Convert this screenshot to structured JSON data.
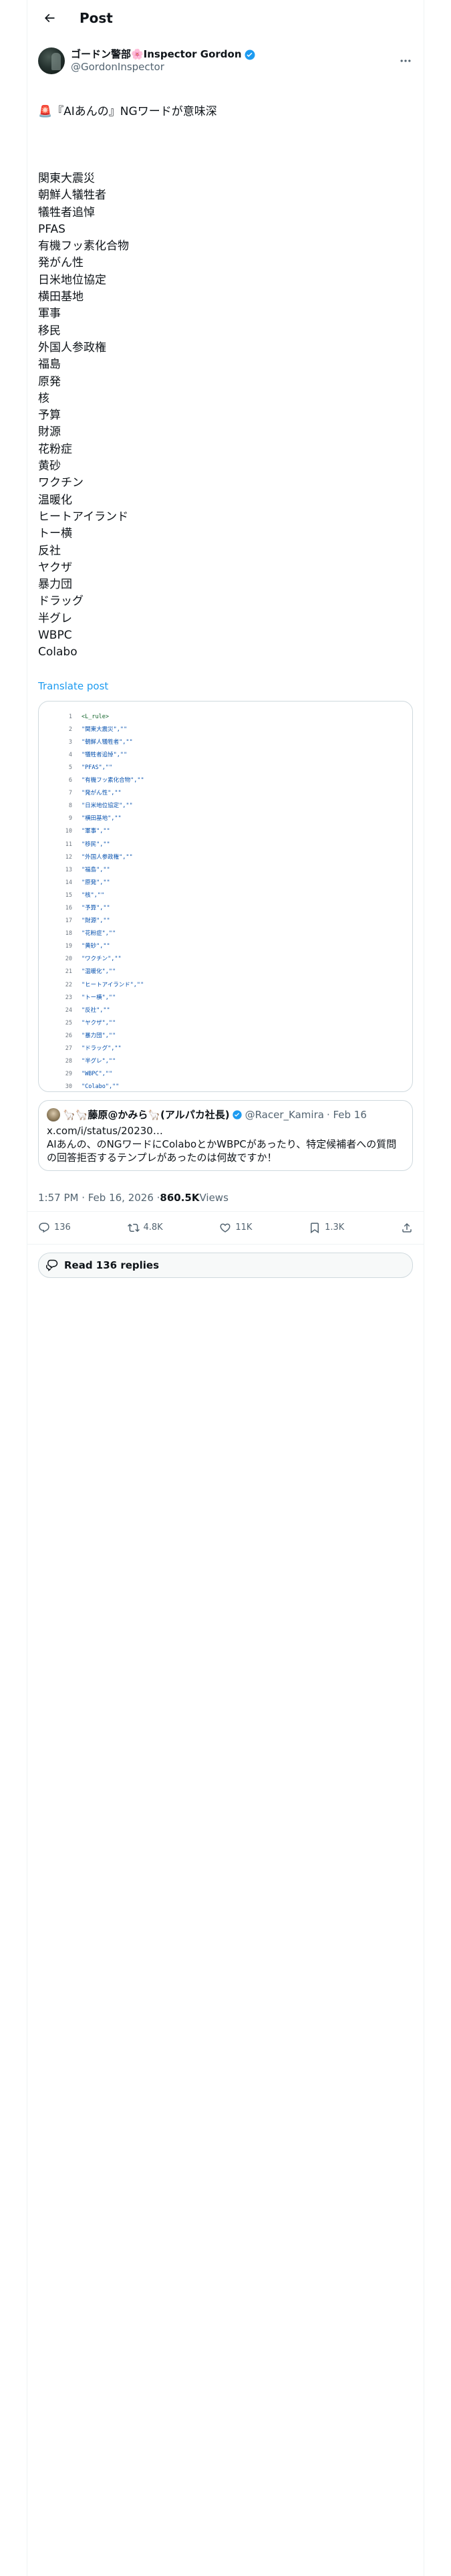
{
  "header": {
    "title": "Post"
  },
  "author": {
    "name": "ゴードン警部🌸Inspector Gordon",
    "handle": "@GordonInspector"
  },
  "tweet": {
    "headline": "🚨『AIあんの』NGワードが意味深",
    "lines": [
      "関東大震災",
      "朝鮮人犠牲者",
      "犠牲者追悼",
      "PFAS",
      "有機フッ素化合物",
      "発がん性",
      "日米地位協定",
      "横田基地",
      "軍事",
      "移民",
      "外国人参政権",
      "福島",
      "原発",
      "核",
      "予算",
      "財源",
      "花粉症",
      "黄砂",
      "ワクチン",
      "温暖化",
      "ヒートアイランド",
      "トー横",
      "反社",
      "ヤクザ",
      "暴力団",
      "ドラッグ",
      "半グレ",
      "WBPC",
      "Colabo"
    ],
    "translate_label": "Translate post"
  },
  "code_image": {
    "rows": [
      {
        "n": "1",
        "t": "<L_rule>"
      },
      {
        "n": "2",
        "t": "\"関東大震災\",\"\""
      },
      {
        "n": "3",
        "t": "\"朝鮮人犠牲者\",\"\""
      },
      {
        "n": "4",
        "t": "\"犠牲者追悼\",\"\""
      },
      {
        "n": "5",
        "t": "\"PFAS\",\"\""
      },
      {
        "n": "6",
        "t": "\"有機フッ素化合物\",\"\""
      },
      {
        "n": "7",
        "t": "\"発がん性\",\"\""
      },
      {
        "n": "8",
        "t": "\"日米地位協定\",\"\""
      },
      {
        "n": "9",
        "t": "\"横田基地\",\"\""
      },
      {
        "n": "10",
        "t": "\"軍事\",\"\""
      },
      {
        "n": "11",
        "t": "\"移民\",\"\""
      },
      {
        "n": "12",
        "t": "\"外国人参政権\",\"\""
      },
      {
        "n": "13",
        "t": "\"福島\",\"\""
      },
      {
        "n": "14",
        "t": "\"原発\",\"\""
      },
      {
        "n": "15",
        "t": "\"核\",\"\""
      },
      {
        "n": "16",
        "t": "\"予算\",\"\""
      },
      {
        "n": "17",
        "t": "\"財源\",\"\""
      },
      {
        "n": "18",
        "t": "\"花粉症\",\"\""
      },
      {
        "n": "19",
        "t": "\"黄砂\",\"\""
      },
      {
        "n": "20",
        "t": "\"ワクチン\",\"\""
      },
      {
        "n": "21",
        "t": "\"温暖化\",\"\""
      },
      {
        "n": "22",
        "t": "\"ヒートアイランド\",\"\""
      },
      {
        "n": "23",
        "t": "\"トー横\",\"\""
      },
      {
        "n": "24",
        "t": "\"反社\",\"\""
      },
      {
        "n": "25",
        "t": "\"ヤクザ\",\"\""
      },
      {
        "n": "26",
        "t": "\"暴力団\",\"\""
      },
      {
        "n": "27",
        "t": "\"ドラッグ\",\"\""
      },
      {
        "n": "28",
        "t": "\"半グレ\",\"\""
      },
      {
        "n": "29",
        "t": "\"WBPC\",\"\""
      },
      {
        "n": "30",
        "t": "\"Colabo\",\"\""
      }
    ]
  },
  "quote": {
    "name": "🦙🦙藤原@かみら🦙(アルパカ社長)",
    "handle": "@Racer_Kamira",
    "date": "· Feb 16",
    "text": "x.com/i/status/20230…\nAIあんの、のNGワードにColaboとかWBPCがあったり、特定候補者への質問の回答拒否するテンプレがあったのは何故ですか！"
  },
  "meta": {
    "time": "1:57 PM · Feb 16, 2026 · ",
    "views_value": "860.5K",
    "views_label": " Views"
  },
  "actions": {
    "reply_count": "136",
    "repost_count": "4.8K",
    "like_count": "11K",
    "bookmark_count": "1.3K"
  },
  "replies_button": {
    "label": "Read 136 replies"
  },
  "colors": {
    "accent": "#1d9bf0",
    "text": "#0f1419",
    "muted": "#536471",
    "border": "#cfd9de"
  }
}
